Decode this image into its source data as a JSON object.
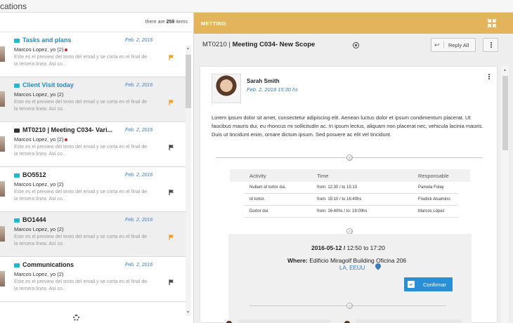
{
  "top": {
    "title": "cations"
  },
  "list": {
    "count_prefix": "there are ",
    "count": "259",
    "count_suffix": " items",
    "items": [
      {
        "title": "Tasks and plans",
        "title_style": "blue",
        "date": "Feb. 2, 2016",
        "from": "Marcos Lopez, yo (2)",
        "unread": true,
        "preview": "Este es el preview del texto del email y se corta en el final de la tercera linea. Así co..",
        "flag_color": "#f0a020",
        "icon": "envelope-icon",
        "selected": false
      },
      {
        "title": "Client Visit today",
        "title_style": "blue",
        "date": "Feb. 2, 2016",
        "from": "Marcos Lopez, yo (2)",
        "unread": false,
        "preview": "Este es el preview del texto del email y se corta en el final de la tercera linea. Así co..",
        "flag_color": "#f0a020",
        "icon": "envelope-icon",
        "selected": true
      },
      {
        "title": "MT0210 | Meeting  C034- Vari...",
        "title_style": "dark",
        "date": "Feb. 2, 2016",
        "from": "Marcos Lopez, yo (2)",
        "unread": true,
        "preview": "Este es el preview del texto del email y se corta en el final de la tercera linea. Así co..",
        "flag_color": "#444444",
        "icon": "envelope-open-icon",
        "selected": false
      },
      {
        "title": "BO5512",
        "title_style": "dark",
        "date": "Feb. 2, 2016",
        "from": "Marcos Lopez, yo (2)",
        "unread": false,
        "preview": "Este es el preview del texto del email y se corta en el final de la tercera linea. Así co..",
        "flag_color": "#444444",
        "icon": "envelope-icon",
        "selected": false
      },
      {
        "title": "BO1444",
        "title_style": "dark",
        "date": "Feb. 2, 2016",
        "from": "Marcos Lopez, yo (2)",
        "unread": false,
        "preview": "Este es el preview del texto del email y se corta en el final de la tercera linea. Así co..",
        "flag_color": "#f0a020",
        "icon": "envelope-icon",
        "selected": true
      },
      {
        "title": "Communications",
        "title_style": "dark",
        "date": "Feb. 2, 2016",
        "from": "Marcos Lopez, yo (2)",
        "unread": false,
        "preview": "Este es el preview del texto del email y se corta en el final de la tercera linea. Así co..",
        "flag_color": "#444444",
        "icon": "envelope-icon",
        "selected": false
      }
    ]
  },
  "detail": {
    "header_label": "METTING",
    "subject_code": "MT0210 | ",
    "subject_title": "Meeting  C034- New Scope",
    "reply_all": "Reply All",
    "sender": "Sarah Smith",
    "sent": "Feb. 2, 2018  15:30 hs",
    "body": "Lorem ipsum dolor sit amet, consectetur adipiscing elit. Aenean luctus dolor et ipsum condimentum placerat. Ut faucibus mauris dui, eu rhoncus mi sollicitudin ac. In ipsum lectus, aliquam non placerat nec, vehicula lacinia mauris. Duis ut tincidunt enim, ornare dictum ipsum. Sed posuere ac elit vel tincidunt.",
    "table": {
      "headers": [
        "Activity",
        "Time",
        "Responsable"
      ],
      "rows": [
        [
          "Nullam id tortor dui.",
          "from: 12:30 / to 15:10",
          "Pamela Folay"
        ],
        [
          "Id tortor.",
          "from: 15:10 / to 16:40hs",
          "Fredick Alsamino"
        ],
        [
          "Dortor dui.",
          "from: 16:40hs / to: 19:00hs",
          "Marcos López"
        ]
      ]
    },
    "event": {
      "date": "2016-05-12",
      "time_sep": "  / ",
      "time": "12:50 to 17:20",
      "where_label": "Where:",
      "where": "Edificio Miragolf Building Oficina 206",
      "location": "LA, EEUU",
      "confirm": "Confirmar"
    },
    "colors": {
      "header": "#e3b45c",
      "accent_blue": "#2b8fd8",
      "link": "#3a7bbf",
      "unread_dot": "#e02020",
      "flag_orange": "#f0a020"
    }
  }
}
